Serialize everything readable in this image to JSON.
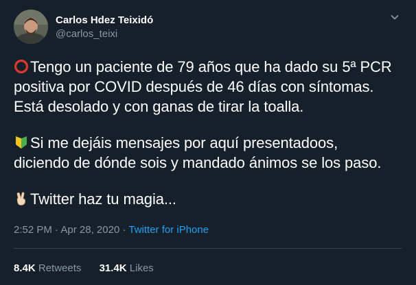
{
  "author": {
    "display_name": "Carlos Hdez Teixidó",
    "handle": "@carlos_teixi"
  },
  "tweet": {
    "paragraphs": [
      {
        "emoji": "red-circle-icon",
        "lines": [
          "Tengo un paciente de 79 años que ha dado su 5ª PCR",
          "positiva por COVID después de 46 días con síntomas.",
          "Está desolado y con ganas de tirar la toalla."
        ]
      },
      {
        "emoji": "japanese-beginner-symbol-icon",
        "lines": [
          "Si me dejáis mensajes por aquí presentadoos,",
          "diciendo de dónde sois y mandado ánimos se los paso."
        ]
      },
      {
        "emoji": "victory-hand-icon",
        "lines": [
          "Twitter haz tu magia..."
        ]
      }
    ]
  },
  "meta": {
    "time": "2:52 PM",
    "separator_1": " · ",
    "date": "Apr 28, 2020",
    "separator_2": " · ",
    "source": "Twitter for iPhone"
  },
  "stats": {
    "retweets_count": "8.4K",
    "retweets_label": "Retweets",
    "likes_count": "31.4K",
    "likes_label": "Likes"
  },
  "colors": {
    "background": "#15202b",
    "text_primary": "#ffffff",
    "text_secondary": "#8899a6",
    "accent": "#1da1f2",
    "divider": "#38444d"
  },
  "icons": {
    "menu": "chevron-down-icon"
  }
}
